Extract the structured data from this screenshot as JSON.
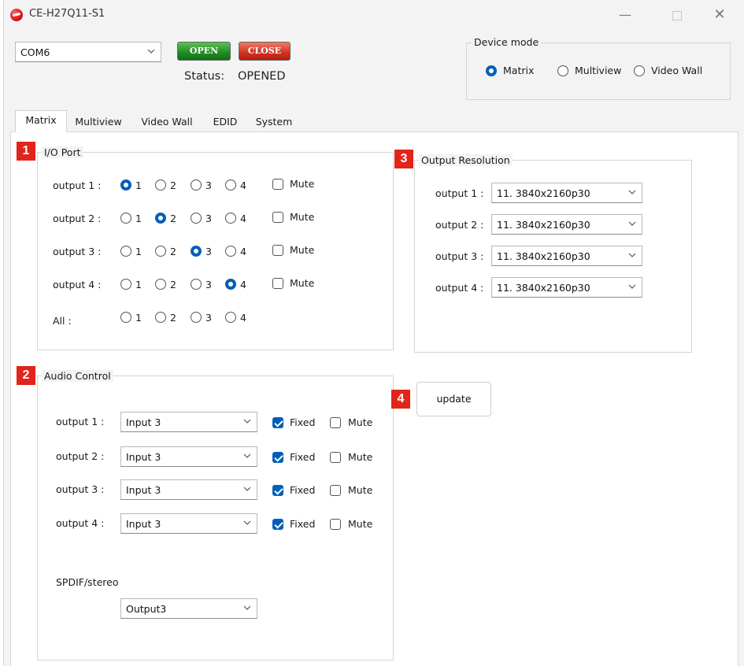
{
  "window": {
    "title": "CE-H27Q11-S1",
    "minimize": "—",
    "close": "✕"
  },
  "connection": {
    "port_value": "COM6",
    "open_label": "OPEN",
    "close_label": "CLOSE",
    "status_label": "Status:",
    "status_value": "OPENED"
  },
  "device_mode": {
    "title": "Device mode",
    "options": [
      "Matrix",
      "Multiview",
      "Video Wall"
    ],
    "selected": "Matrix"
  },
  "tabs": [
    "Matrix",
    "Multiview",
    "Video Wall",
    "EDID",
    "System"
  ],
  "active_tab": "Matrix",
  "badges": [
    "1",
    "2",
    "3",
    "4"
  ],
  "io_port": {
    "title": "I/O Port",
    "rows": [
      {
        "label": "output 1 :",
        "selected": "1",
        "mute": false
      },
      {
        "label": "output 2 :",
        "selected": "2",
        "mute": false
      },
      {
        "label": "output 3 :",
        "selected": "3",
        "mute": false
      },
      {
        "label": "output 4 :",
        "selected": "4",
        "mute": false
      }
    ],
    "all_label": "All :",
    "options": [
      "1",
      "2",
      "3",
      "4"
    ],
    "mute_label": "Mute"
  },
  "output_resolution": {
    "title": "Output Resolution",
    "rows": [
      {
        "label": "output 1 :",
        "value": "11. 3840x2160p30"
      },
      {
        "label": "output 2 :",
        "value": "11. 3840x2160p30"
      },
      {
        "label": "output 3 :",
        "value": "11. 3840x2160p30"
      },
      {
        "label": "output 4 :",
        "value": "11. 3840x2160p30"
      }
    ]
  },
  "audio_control": {
    "title": "Audio Control",
    "rows": [
      {
        "label": "output 1 :",
        "value": "Input 3",
        "fixed": true,
        "mute": false
      },
      {
        "label": "output 2 :",
        "value": "Input 3",
        "fixed": true,
        "mute": false
      },
      {
        "label": "output 3 :",
        "value": "Input 3",
        "fixed": true,
        "mute": false
      },
      {
        "label": "output 4 :",
        "value": "Input 3",
        "fixed": true,
        "mute": false
      }
    ],
    "fixed_label": "Fixed",
    "mute_label": "Mute",
    "spdif_label": "SPDIF/stereo",
    "spdif_value": "Output3"
  },
  "update_label": "update",
  "colors": {
    "accent": "#005fb8",
    "badge": "#e1251b",
    "open_btn": "#1f8b22",
    "close_btn": "#d2301f"
  }
}
